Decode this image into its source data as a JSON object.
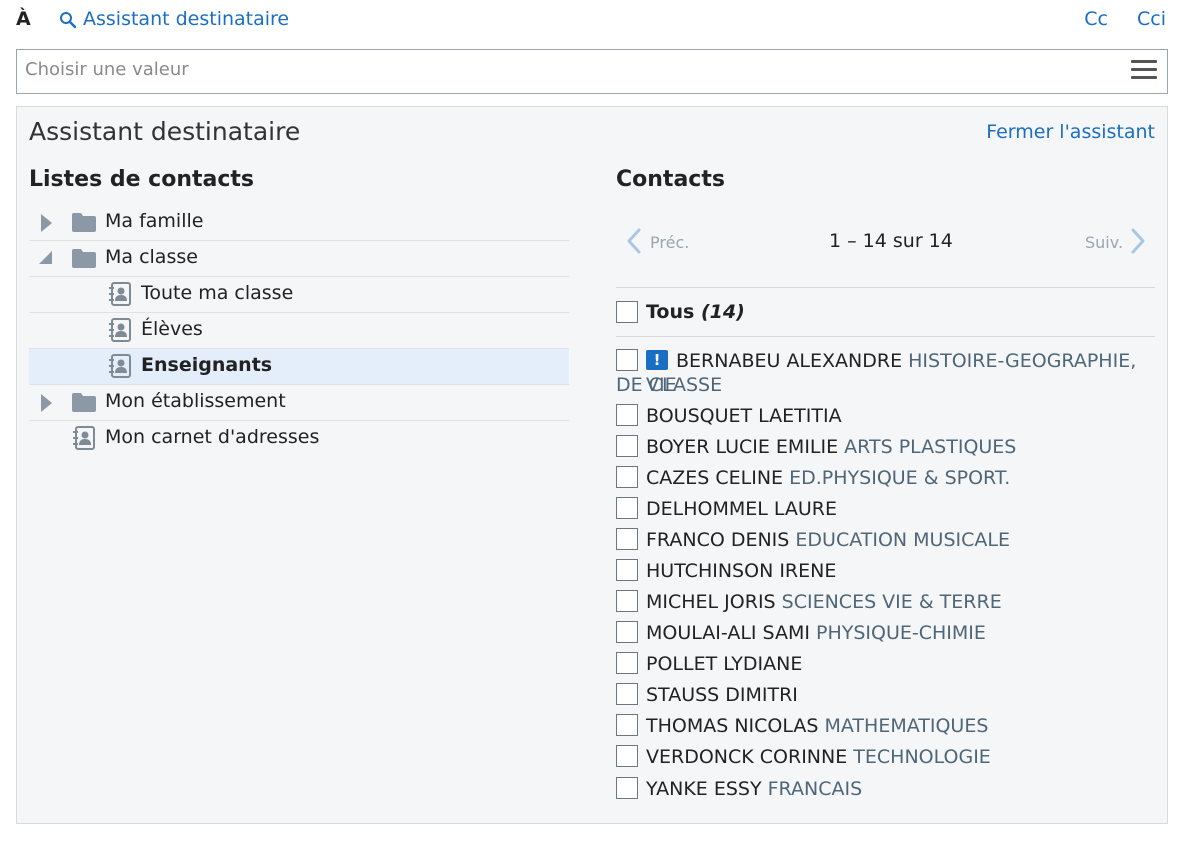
{
  "header": {
    "to_label": "À",
    "assistant_link": "Assistant destinataire",
    "cc": "Cc",
    "cci": "Cci"
  },
  "value_field": {
    "placeholder": "Choisir une valeur"
  },
  "panel": {
    "title": "Assistant destinataire",
    "close": "Fermer l'assistant"
  },
  "lists": {
    "heading": "Listes de contacts",
    "items": [
      {
        "label": "Ma famille",
        "type": "folder",
        "state": "collapsed"
      },
      {
        "label": "Ma classe",
        "type": "folder",
        "state": "expanded"
      },
      {
        "label": "Toute ma classe",
        "type": "list"
      },
      {
        "label": "Élèves",
        "type": "list"
      },
      {
        "label": "Enseignants",
        "type": "list",
        "selected": true
      },
      {
        "label": "Mon établissement",
        "type": "folder",
        "state": "collapsed"
      },
      {
        "label": "Mon carnet d'adresses",
        "type": "list"
      }
    ]
  },
  "contacts": {
    "heading": "Contacts",
    "prev": "Préc.",
    "next": "Suiv.",
    "page_count": "1 – 14 sur 14",
    "all_label": "Tous",
    "all_count": "(14)",
    "items": [
      {
        "name": "BERNABEU ALEXANDRE",
        "subject": "HISTOIRE-GEOGRAPHIE, VIE",
        "subject_cont": "DE CLASSE",
        "alert": true
      },
      {
        "name": "BOUSQUET LAETITIA",
        "subject": ""
      },
      {
        "name": "BOYER LUCIE EMILIE",
        "subject": "ARTS PLASTIQUES"
      },
      {
        "name": "CAZES CELINE",
        "subject": "ED.PHYSIQUE & SPORT."
      },
      {
        "name": "DELHOMMEL LAURE",
        "subject": ""
      },
      {
        "name": "FRANCO DENIS",
        "subject": "EDUCATION MUSICALE"
      },
      {
        "name": "HUTCHINSON IRENE",
        "subject": ""
      },
      {
        "name": "MICHEL JORIS",
        "subject": "SCIENCES VIE & TERRE"
      },
      {
        "name": "MOULAI-ALI SAMI",
        "subject": "PHYSIQUE-CHIMIE"
      },
      {
        "name": "POLLET LYDIANE",
        "subject": ""
      },
      {
        "name": "STAUSS DIMITRI",
        "subject": ""
      },
      {
        "name": "THOMAS NICOLAS",
        "subject": "MATHEMATIQUES"
      },
      {
        "name": "VERDONCK CORINNE",
        "subject": "TECHNOLOGIE"
      },
      {
        "name": "YANKE ESSY",
        "subject": "FRANCAIS"
      }
    ]
  },
  "icons": {
    "search": "search-icon",
    "menu": "hamburger-menu-icon",
    "folder": "folder-icon",
    "list": "contact-book-icon",
    "alert": "alert-icon",
    "prev": "chevron-left-icon",
    "next": "chevron-right-icon"
  },
  "colors": {
    "link": "#1a6fc4",
    "selected_row": "#e3eefa",
    "subject": "#4e6678"
  }
}
